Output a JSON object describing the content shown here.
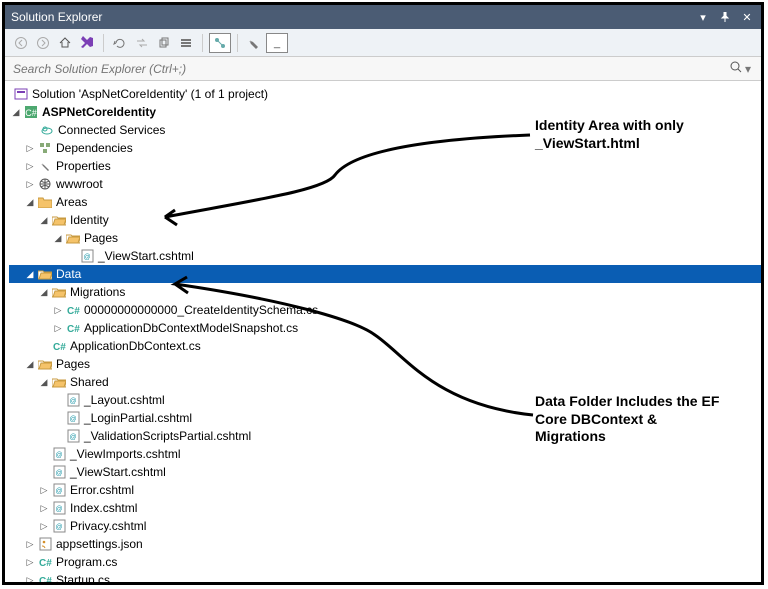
{
  "title": "Solution Explorer",
  "search_placeholder": "Search Solution Explorer (Ctrl+;)",
  "solution_line": "Solution 'AspNetCoreIdentity' (1 of 1 project)",
  "project": "ASPNetCoreIdentity",
  "nodes": {
    "connected": "Connected Services",
    "deps": "Dependencies",
    "props": "Properties",
    "wwwroot": "wwwroot",
    "areas": "Areas",
    "identity": "Identity",
    "identity_pages": "Pages",
    "viewstart_id": "_ViewStart.cshtml",
    "data": "Data",
    "migrations": "Migrations",
    "create_schema": "00000000000000_CreateIdentitySchema.cs",
    "snapshot": "ApplicationDbContextModelSnapshot.cs",
    "appdbcontext": "ApplicationDbContext.cs",
    "pages": "Pages",
    "shared": "Shared",
    "layout": "_Layout.cshtml",
    "loginpartial": "_LoginPartial.cshtml",
    "validation": "_ValidationScriptsPartial.cshtml",
    "viewimports": "_ViewImports.cshtml",
    "viewstart_pages": "_ViewStart.cshtml",
    "error": "Error.cshtml",
    "index": "Index.cshtml",
    "privacy": "Privacy.cshtml",
    "appsettings": "appsettings.json",
    "program": "Program.cs",
    "startup": "Startup.cs"
  },
  "annotations": {
    "a1_line1": "Identity Area with only",
    "a1_line2": "_ViewStart.html",
    "a2_line1": "Data Folder Includes the EF",
    "a2_line2": "Core DBContext &",
    "a2_line3": "Migrations"
  },
  "icons": {
    "home": "⌂",
    "refresh": "⟲",
    "sync": "⇆",
    "copy": "⧉",
    "stack": "▤",
    "graph": "⬡",
    "wrench": "🔧",
    "insert": "_",
    "back": "◯",
    "fwd": "◯",
    "vs": "▣",
    "search": "🔍",
    "dropdown": "▾",
    "pin": "📌",
    "close": "✕"
  }
}
